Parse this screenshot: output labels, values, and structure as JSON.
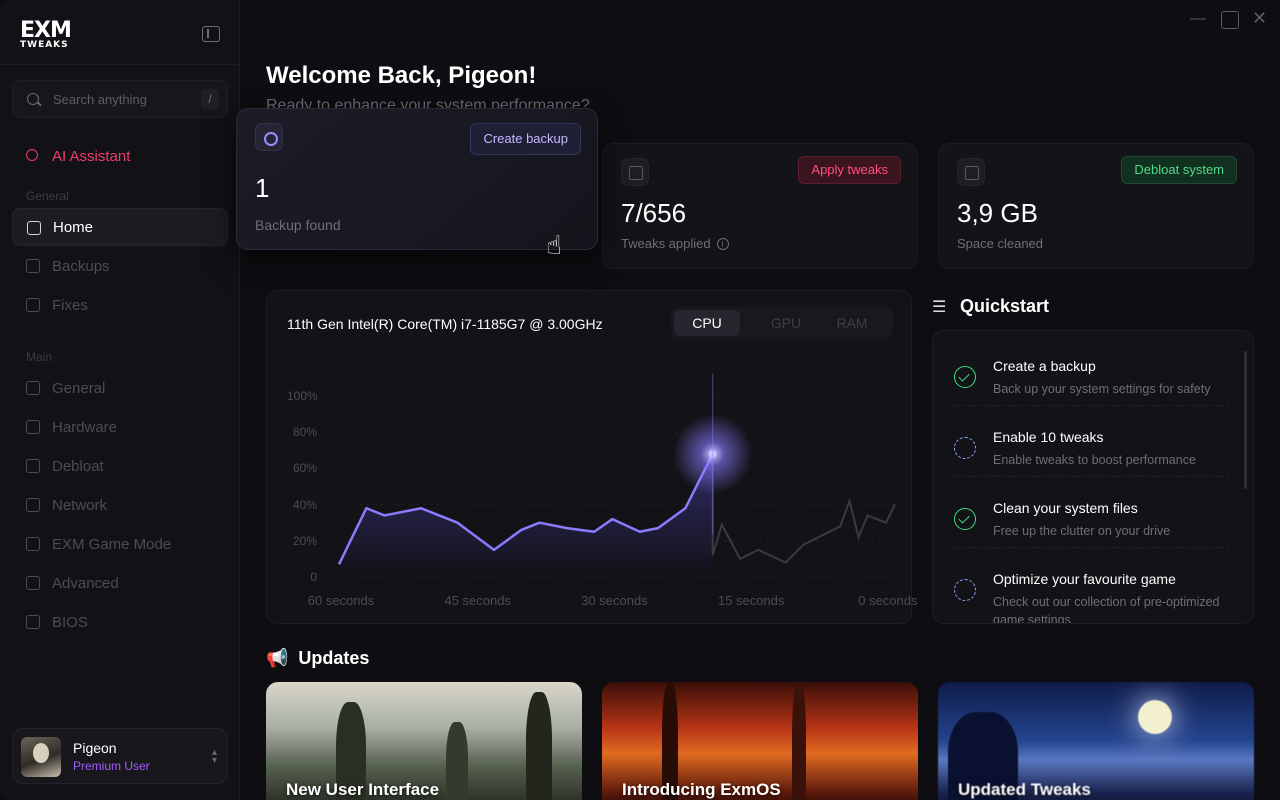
{
  "app": {
    "logo_top": "EXM",
    "logo_bottom": "TWEAKS"
  },
  "sidebar": {
    "search_placeholder": "Search anything",
    "search_shortcut": "/",
    "ai_item": "AI Assistant",
    "section_general": "General",
    "general_items": [
      {
        "label": "Home",
        "icon": "home-icon",
        "active": true
      },
      {
        "label": "Backups",
        "icon": "power-icon"
      },
      {
        "label": "Fixes",
        "icon": "wrench-icon"
      }
    ],
    "section_main": "Main",
    "main_items": [
      {
        "label": "General",
        "icon": "grid-icon"
      },
      {
        "label": "Hardware",
        "icon": "chip-icon"
      },
      {
        "label": "Debloat",
        "icon": "broom-icon"
      },
      {
        "label": "Network",
        "icon": "network-icon"
      },
      {
        "label": "EXM Game Mode",
        "icon": "gamepad-icon"
      },
      {
        "label": "Advanced",
        "icon": "rocket-icon"
      },
      {
        "label": "BIOS",
        "icon": "bios-icon"
      }
    ],
    "user": {
      "name": "Pigeon",
      "role": "Premium User"
    }
  },
  "header": {
    "title": "Welcome Back, Pigeon!",
    "subtitle": "Ready to enhance your system performance?"
  },
  "stats": [
    {
      "value": "1",
      "label": "Backup found",
      "action": "Create backup",
      "icon": "power-icon"
    },
    {
      "value": "7/656",
      "label": "Tweaks applied",
      "action": "Apply tweaks",
      "icon": "grid-icon"
    },
    {
      "value": "3,9 GB",
      "label": "Space cleaned",
      "action": "Debloat system",
      "icon": "broom-icon"
    }
  ],
  "chart": {
    "cpu_name": "11th Gen Intel(R) Core(TM) i7-1185G7 @ 3.00GHz",
    "tabs": [
      "CPU",
      "GPU",
      "RAM"
    ],
    "active_tab": "CPU"
  },
  "chart_data": {
    "type": "line",
    "title": "",
    "xlabel": "",
    "ylabel": "",
    "ylim": [
      0,
      100
    ],
    "y_ticks": [
      "100%",
      "80%",
      "60%",
      "40%",
      "20%",
      "0"
    ],
    "x_ticks": [
      "60 seconds",
      "45 seconds",
      "30 seconds",
      "15 seconds",
      "0 seconds"
    ],
    "x": [
      60,
      57,
      55,
      51,
      47,
      43,
      40,
      38,
      35,
      32,
      30,
      27,
      25,
      22,
      19,
      19,
      18,
      16,
      14,
      11,
      9,
      5,
      4,
      3,
      2,
      0,
      -1
    ],
    "values": [
      7,
      38,
      34,
      38,
      30,
      15,
      26,
      30,
      27,
      25,
      32,
      25,
      27,
      38,
      68,
      12,
      29,
      10,
      15,
      8,
      18,
      28,
      42,
      22,
      34,
      30,
      40
    ],
    "highlight_index": 14,
    "accent_color": "#8b7bff"
  },
  "quickstart": {
    "title": "Quickstart",
    "items": [
      {
        "title": "Create a backup",
        "desc": "Back up your system settings for safety",
        "done": true
      },
      {
        "title": "Enable 10 tweaks",
        "desc": "Enable tweaks to boost performance",
        "done": false
      },
      {
        "title": "Clean your system files",
        "desc": "Free up the clutter on your drive",
        "done": true
      },
      {
        "title": "Optimize your favourite game",
        "desc": "Check out our collection of pre-optimized game settings",
        "done": false
      }
    ]
  },
  "updates": {
    "title": "Updates",
    "cards": [
      {
        "title": "New User Interface"
      },
      {
        "title": "Introducing ExmOS"
      },
      {
        "title": "Updated Tweaks"
      }
    ]
  },
  "colors": {
    "ai_accent": "#ef3d6b",
    "premium": "#a45cff",
    "apply": "#ff4f7b",
    "debloat": "#53d98a"
  }
}
